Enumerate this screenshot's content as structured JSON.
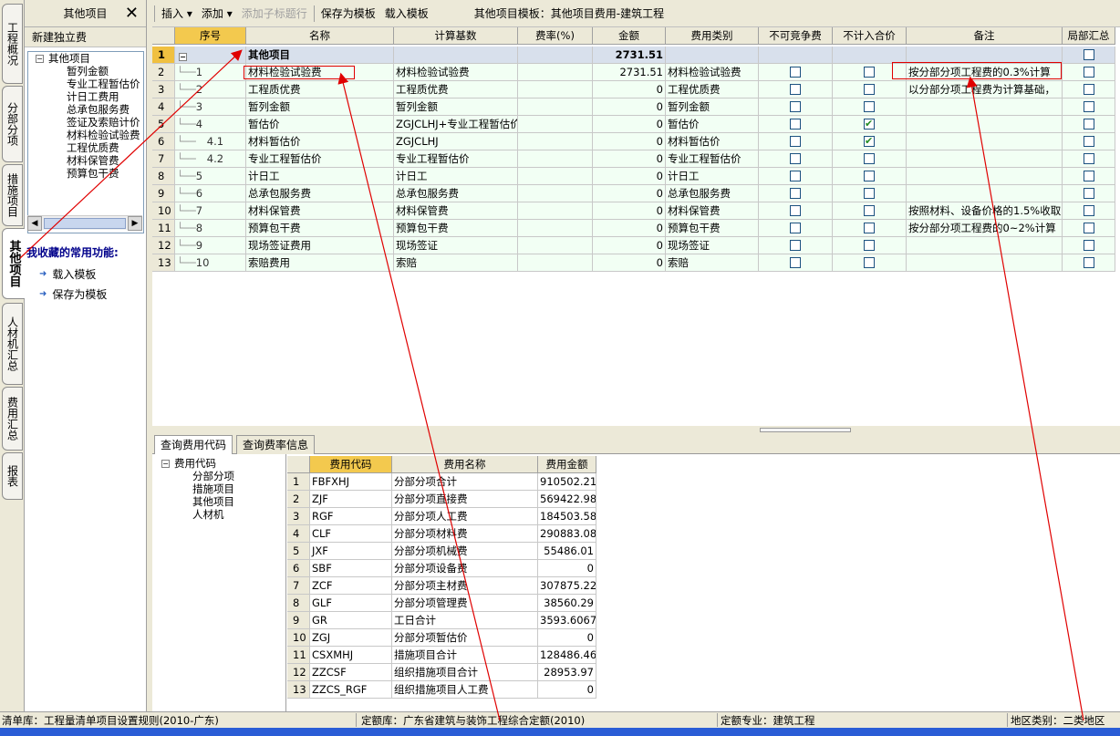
{
  "vtabs": [
    "工程概况",
    "分部分项",
    "措施项目",
    "其他项目",
    "人材机汇总",
    "费用汇总",
    "报表"
  ],
  "left_panel": {
    "title": "其他项目",
    "new_independent": "新建独立费",
    "tree_root": "其他项目",
    "tree_items": [
      "暂列金额",
      "专业工程暂估价",
      "计日工费用",
      "总承包服务费",
      "签证及索赔计价",
      "材料检验试验费",
      "工程优质费",
      "材料保管费",
      "预算包干费"
    ],
    "fav_title": "我收藏的常用功能:",
    "fav_items": [
      "载入模板",
      "保存为模板"
    ]
  },
  "toolbar": {
    "insert": "插入",
    "add": "添加",
    "add_sub_title": "添加子标题行",
    "save_template": "保存为模板",
    "load_template": "载入模板",
    "template_title": "其他项目模板：其他项目费用-建筑工程"
  },
  "grid": {
    "headers": [
      "序号",
      "名称",
      "计算基数",
      "费率(%)",
      "金额",
      "费用类别",
      "不可竞争费",
      "不计入合价",
      "备注",
      "局部汇总"
    ],
    "main_row": {
      "rn": "1",
      "seq": "−",
      "name": "其他项目",
      "amount": "2731.51"
    },
    "rows": [
      {
        "rn": "2",
        "seq": "1",
        "name": "材料检验试验费",
        "base": "材料检验试验费",
        "amount": "2731.51",
        "category": "材料检验试验费",
        "no_compete": false,
        "no_total": false,
        "remark": "按分部分项工程费的0.3%计算"
      },
      {
        "rn": "3",
        "seq": "2",
        "name": "工程质优费",
        "base": "工程质优费",
        "amount": "0",
        "category": "工程优质费",
        "no_compete": false,
        "no_total": false,
        "remark": "以分部分项工程费为计算基础，"
      },
      {
        "rn": "4",
        "seq": "3",
        "name": "暂列金额",
        "base": "暂列金额",
        "amount": "0",
        "category": "暂列金额",
        "no_compete": false,
        "no_total": false,
        "remark": ""
      },
      {
        "rn": "5",
        "seq": "4",
        "name": "暂估价",
        "base": "ZGJCLHJ+专业工程暂估价",
        "amount": "0",
        "category": "暂估价",
        "no_compete": false,
        "no_total": true,
        "remark": ""
      },
      {
        "rn": "6",
        "seq": "4.1",
        "name": "材料暂估价",
        "base": "ZGJCLHJ",
        "amount": "0",
        "category": "材料暂估价",
        "no_compete": false,
        "no_total": true,
        "remark": ""
      },
      {
        "rn": "7",
        "seq": "4.2",
        "name": "专业工程暂估价",
        "base": "专业工程暂估价",
        "amount": "0",
        "category": "专业工程暂估价",
        "no_compete": false,
        "no_total": false,
        "remark": ""
      },
      {
        "rn": "8",
        "seq": "5",
        "name": "计日工",
        "base": "计日工",
        "amount": "0",
        "category": "计日工",
        "no_compete": false,
        "no_total": false,
        "remark": ""
      },
      {
        "rn": "9",
        "seq": "6",
        "name": "总承包服务费",
        "base": "总承包服务费",
        "amount": "0",
        "category": "总承包服务费",
        "no_compete": false,
        "no_total": false,
        "remark": ""
      },
      {
        "rn": "10",
        "seq": "7",
        "name": "材料保管费",
        "base": "材料保管费",
        "amount": "0",
        "category": "材料保管费",
        "no_compete": false,
        "no_total": false,
        "remark": "按照材料、设备价格的1.5%收取"
      },
      {
        "rn": "11",
        "seq": "8",
        "name": "预算包干费",
        "base": "预算包干费",
        "amount": "0",
        "category": "预算包干费",
        "no_compete": false,
        "no_total": false,
        "remark": "按分部分项工程费的0~2%计算"
      },
      {
        "rn": "12",
        "seq": "9",
        "name": "现场签证费用",
        "base": "现场签证",
        "amount": "0",
        "category": "现场签证",
        "no_compete": false,
        "no_total": false,
        "remark": ""
      },
      {
        "rn": "13",
        "seq": "10",
        "name": "索赔费用",
        "base": "索赔",
        "amount": "0",
        "category": "索赔",
        "no_compete": false,
        "no_total": false,
        "remark": ""
      }
    ]
  },
  "bottom": {
    "tabs": [
      "查询费用代码",
      "查询费率信息"
    ],
    "tree_root": "费用代码",
    "tree_items": [
      "分部分项",
      "措施项目",
      "其他项目",
      "人材机"
    ],
    "headers": [
      "费用代码",
      "费用名称",
      "费用金额"
    ],
    "rows": [
      {
        "rn": "1",
        "code": "FBFXHJ",
        "name": "分部分项合计",
        "amount": "910502.21"
      },
      {
        "rn": "2",
        "code": "ZJF",
        "name": "分部分项直接费",
        "amount": "569422.98"
      },
      {
        "rn": "3",
        "code": "RGF",
        "name": "分部分项人工费",
        "amount": "184503.58"
      },
      {
        "rn": "4",
        "code": "CLF",
        "name": "分部分项材料费",
        "amount": "290883.08"
      },
      {
        "rn": "5",
        "code": "JXF",
        "name": "分部分项机械费",
        "amount": "55486.01"
      },
      {
        "rn": "6",
        "code": "SBF",
        "name": "分部分项设备费",
        "amount": "0"
      },
      {
        "rn": "7",
        "code": "ZCF",
        "name": "分部分项主材费",
        "amount": "307875.22"
      },
      {
        "rn": "8",
        "code": "GLF",
        "name": "分部分项管理费",
        "amount": "38560.29"
      },
      {
        "rn": "9",
        "code": "GR",
        "name": "工日合计",
        "amount": "3593.6067"
      },
      {
        "rn": "10",
        "code": "ZGJ",
        "name": "分部分项暂估价",
        "amount": "0"
      },
      {
        "rn": "11",
        "code": "CSXMHJ",
        "name": "措施项目合计",
        "amount": "128486.46"
      },
      {
        "rn": "12",
        "code": "ZZCSF",
        "name": "组织措施项目合计",
        "amount": "28953.97"
      },
      {
        "rn": "13",
        "code": "ZZCS_RGF",
        "name": "组织措施项目人工费",
        "amount": "0"
      }
    ]
  },
  "status": {
    "list_lib": "清单库：工程量清单项目设置规则(2010-广东)",
    "quota_lib": "定额库：广东省建筑与装饰工程综合定额(2010)",
    "quota_major": "定额专业：建筑工程",
    "region": "地区类别：二类地区"
  },
  "colors": {
    "accent_header": "#f3c94e",
    "row_bg": "#f2fff4",
    "main_row": "#d8e0ec",
    "annotation": "#e00000"
  }
}
